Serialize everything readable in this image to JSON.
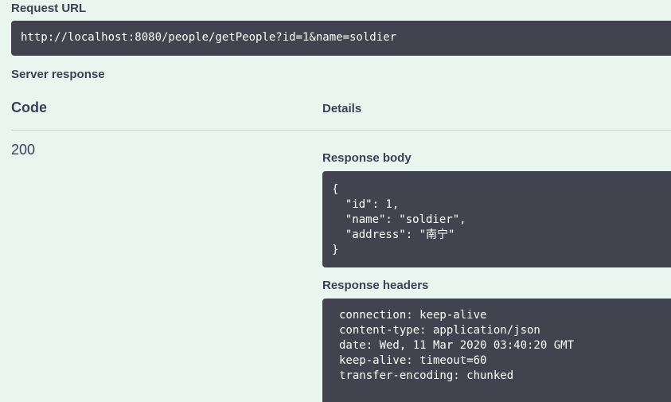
{
  "request_url": {
    "label": "Request URL",
    "value": "http://localhost:8080/people/getPeople?id=1&name=soldier"
  },
  "server_response": {
    "label": "Server response",
    "columns": {
      "code": "Code",
      "details": "Details"
    },
    "code": "200",
    "response_body": {
      "label": "Response body",
      "lines": [
        "{",
        "  \"id\": 1,",
        "  \"name\": \"soldier\",",
        "  \"address\": \"南宁\"",
        "}"
      ]
    },
    "response_headers": {
      "label": "Response headers",
      "lines": [
        "connection: keep-alive",
        "content-type: application/json",
        "date: Wed, 11 Mar 2020 03:40:20 GMT",
        "keep-alive: timeout=60",
        "transfer-encoding: chunked"
      ]
    }
  }
}
